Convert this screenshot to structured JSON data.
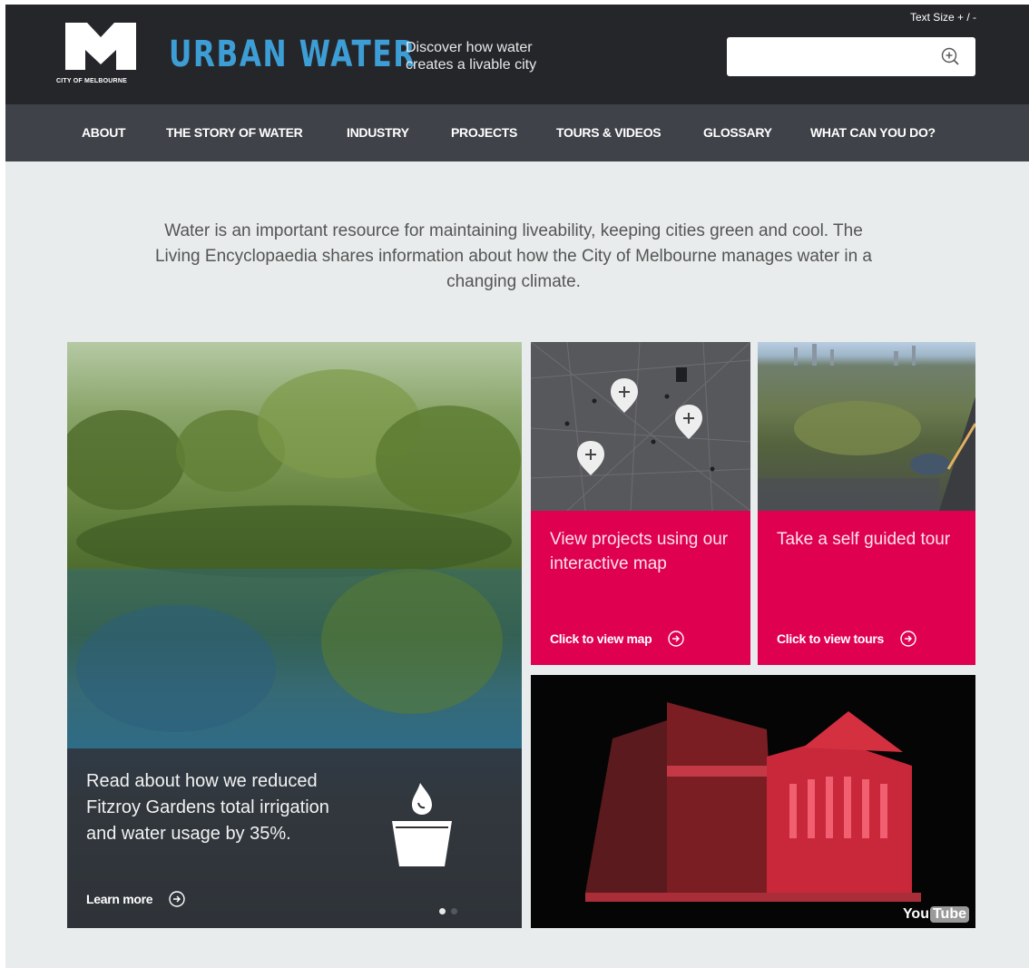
{
  "header": {
    "logo_caption": "CITY OF MELBOURNE",
    "brand_title": "URBAN WATER",
    "tagline": "Discover how water creates a livable city",
    "text_size_label": "Text Size + / -",
    "search": {
      "value": "",
      "placeholder": ""
    }
  },
  "nav": {
    "items": [
      {
        "label": "ABOUT"
      },
      {
        "label": "THE STORY OF WATER"
      },
      {
        "label": "INDUSTRY"
      },
      {
        "label": "PROJECTS"
      },
      {
        "label": "TOURS & VIDEOS"
      },
      {
        "label": "GLOSSARY"
      },
      {
        "label": "WHAT CAN YOU DO?"
      }
    ]
  },
  "intro": {
    "text": "Water is an important resource for maintaining liveability, keeping cities green and cool. The Living Encyclopaedia shares information about how the City of Melbourne manages water in a changing climate."
  },
  "tiles": {
    "feature": {
      "text": "Read about how we reduced Fitzroy Gardens total irrigation and water usage by 35%.",
      "link_label": "Learn more",
      "icon": "candle-icon",
      "slides_total": 2,
      "slide_active": 1
    },
    "map": {
      "title": "View projects using our interactive map",
      "link_label": "Click to view map",
      "icon": "map-pin-icon"
    },
    "tour": {
      "title": "Take a self guided tour",
      "link_label": "Click to view tours"
    },
    "video": {
      "yt_you": "You",
      "yt_tube": "Tube"
    }
  },
  "colors": {
    "header_bg": "#25262a",
    "nav_bg": "#404249",
    "brand_blue": "#3d9ed6",
    "accent_pink": "#df0050",
    "page_bg": "#e9ecec"
  }
}
